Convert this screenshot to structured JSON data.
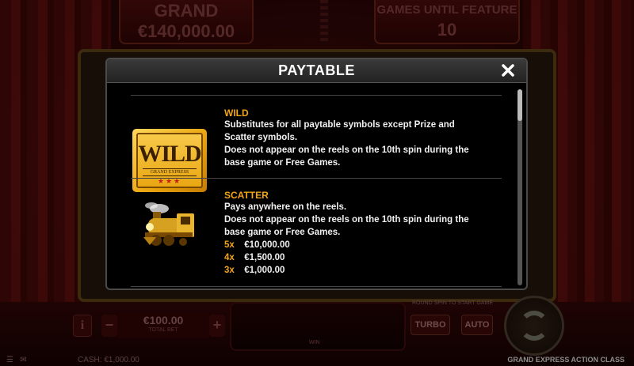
{
  "background": {
    "grand_label": "GRAND",
    "grand_amount": "€140,000.00",
    "games_until_label": "GAMES UNTIL FEATURE",
    "games_until_value": "10",
    "bet_value": "€100.00",
    "bet_label": "TOTAL BET",
    "win_label": "WIN",
    "ways_label": "ROUND SPIN TO START GAME",
    "turbo_label": "TURBO",
    "auto_label": "AUTO",
    "cash_text": "CASH: €1,000.00",
    "game_title": "GRAND EXPRESS ACTION CLASS",
    "info_glyph": "i",
    "minus_glyph": "−",
    "plus_glyph": "+"
  },
  "paytable": {
    "title": "PAYTABLE",
    "close_icon": "close-icon",
    "entries": [
      {
        "symbol": "wild-ticket",
        "symbol_text": "WILD",
        "symbol_subtext": "GRAND EXPRESS",
        "symbol_stars": "★★★",
        "name": "WILD",
        "lines": [
          "Substitutes for all paytable symbols except Prize and",
          "Scatter symbols.",
          "Does not appear on the reels on the 10th spin during the",
          "base game or Free Games."
        ]
      },
      {
        "symbol": "scatter-train",
        "name": "SCATTER",
        "lines": [
          "Pays anywhere on the reels.",
          "Does not appear on the reels on the 10th spin during the",
          "base game or Free Games."
        ],
        "pays": [
          {
            "mult": "5x",
            "value": "€10,000.00"
          },
          {
            "mult": "4x",
            "value": "€1,500.00"
          },
          {
            "mult": "3x",
            "value": "€1,000.00"
          }
        ]
      }
    ]
  },
  "colors": {
    "accent": "#f2a516",
    "text": "#f0f0f0",
    "modal_bg": "#000000"
  }
}
